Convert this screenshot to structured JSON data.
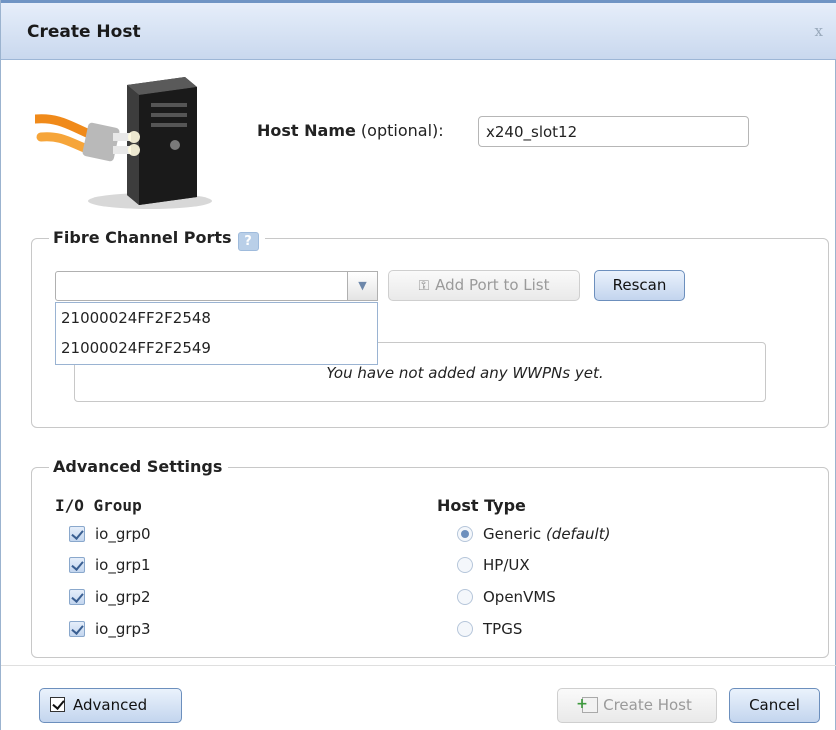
{
  "dialog": {
    "title": "Create Host",
    "close_glyph": "x"
  },
  "host_name": {
    "label_bold": "Host Name",
    "label_suffix": " (optional):",
    "value": "x240_slot12"
  },
  "fibre_channel": {
    "legend": "Fibre Channel Ports",
    "help_glyph": "?",
    "combo_value": "",
    "dropdown_options": [
      "21000024FF2F2548",
      "21000024FF2F2549"
    ],
    "add_port_label": "Add Port to List",
    "rescan_label": "Rescan",
    "empty_message": "You have not added any WWPNs yet."
  },
  "advanced_settings": {
    "legend": "Advanced Settings",
    "io_group_heading": "I/O Group",
    "io_groups": [
      {
        "label": "io_grp0",
        "checked": true
      },
      {
        "label": "io_grp1",
        "checked": true
      },
      {
        "label": "io_grp2",
        "checked": true
      },
      {
        "label": "io_grp3",
        "checked": true
      }
    ],
    "host_type_heading": "Host Type",
    "host_types": [
      {
        "label": "Generic",
        "suffix": "(default)",
        "selected": true
      },
      {
        "label": "HP/UX",
        "suffix": "",
        "selected": false
      },
      {
        "label": "OpenVMS",
        "suffix": "",
        "selected": false
      },
      {
        "label": "TPGS",
        "suffix": "",
        "selected": false
      }
    ]
  },
  "footer": {
    "advanced_label": "Advanced",
    "advanced_checked": true,
    "create_host_label": "Create Host",
    "cancel_label": "Cancel"
  },
  "colors": {
    "title_bar": "#c9d8ee",
    "button_accent": "#6c8fbd",
    "check_mark": "#3a5f92"
  }
}
